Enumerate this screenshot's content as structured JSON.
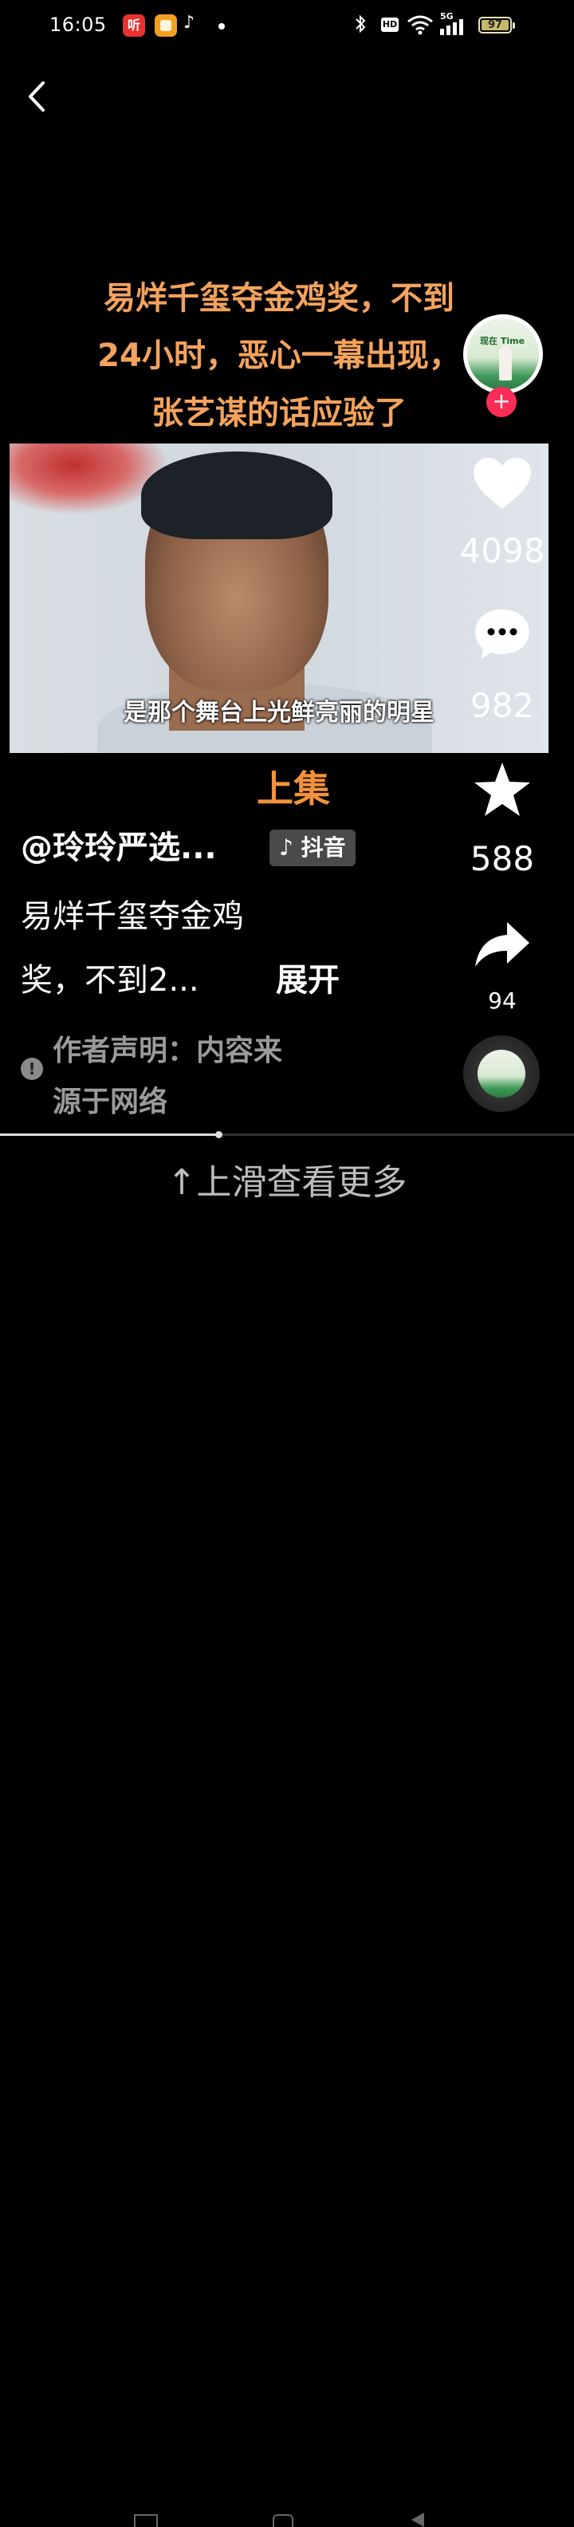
{
  "status_bar": {
    "time": "16:05",
    "app1_glyph": "听",
    "network": "5G",
    "hd": "HD",
    "battery": "97"
  },
  "video": {
    "title_lines": [
      "易烊千玺夺金鸡奖，不到",
      "24小时，恶心一幕出现，",
      "张艺谋的话应验了"
    ],
    "subtitle": "是那个舞台上光鲜亮丽的明星",
    "progress": 0.38
  },
  "actions": {
    "likes": "4098",
    "comments": "982",
    "favorites": "588",
    "shares": "94"
  },
  "info": {
    "prev_episode": "上集",
    "author": "@玲玲严选...",
    "source_badge": "抖音",
    "desc_line1": "易烊千玺夺金鸡",
    "desc_line2": "奖，不到2...",
    "expand": "展开",
    "declaration_lines": [
      "作者声明：内容来",
      "源于网络"
    ]
  },
  "avatar_text": "现在 Time",
  "footer": {
    "swipe_hint": "↑上滑查看更多"
  }
}
